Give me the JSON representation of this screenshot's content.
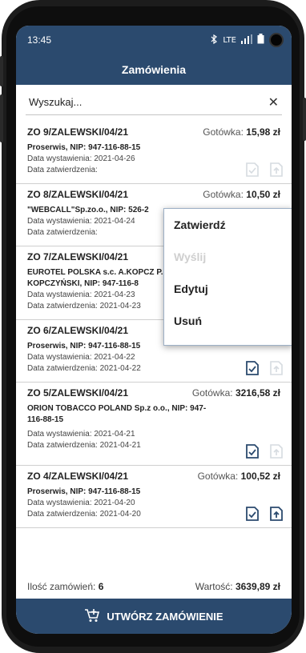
{
  "status_bar": {
    "time": "13:45",
    "network": "LTE"
  },
  "app_bar": {
    "title": "Zamówienia"
  },
  "search": {
    "placeholder": "Wyszukaj...",
    "value": ""
  },
  "orders": [
    {
      "number": "ZO 9/ZALEWSKI/04/21",
      "payment": "Gotówka:",
      "amount": "15,98 zł",
      "client": "Proserwis, NIP: 947-116-88-15",
      "issue_label": "Data wystawienia:",
      "issue_date": "2021-04-26",
      "approve_label": "Data zatwierdzenia:",
      "approve_date": ""
    },
    {
      "number": "ZO 8/ZALEWSKI/04/21",
      "payment": "Gotówka:",
      "amount": "10,50 zł",
      "client": "\"WEBCALL\"Sp.zo.o., NIP: 526-2",
      "issue_label": "Data wystawienia:",
      "issue_date": "2021-04-24",
      "approve_label": "Data zatwierdzenia:",
      "approve_date": ""
    },
    {
      "number": "ZO 7/ZALEWSKI/04/21",
      "payment": "",
      "amount": "",
      "client": "EUROTEL POLSKA s.c. A.KOPCZ P. KOPCZYŃSKI, NIP: 947-116-8",
      "issue_label": "Data wystawienia:",
      "issue_date": "2021-04-23",
      "approve_label": "Data zatwierdzenia:",
      "approve_date": "2021-04-23"
    },
    {
      "number": "ZO 6/ZALEWSKI/04/21",
      "payment": "",
      "amount": "",
      "client": "Proserwis, NIP: 947-116-88-15",
      "issue_label": "Data wystawienia:",
      "issue_date": "2021-04-22",
      "approve_label": "Data zatwierdzenia:",
      "approve_date": "2021-04-22"
    },
    {
      "number": "ZO 5/ZALEWSKI/04/21",
      "payment": "Gotówka:",
      "amount": "3216,58 zł",
      "client": "ORION TOBACCO POLAND Sp.z o.o., NIP: 947-116-88-15",
      "issue_label": "Data wystawienia:",
      "issue_date": "2021-04-21",
      "approve_label": "Data zatwierdzenia:",
      "approve_date": "2021-04-21"
    },
    {
      "number": "ZO 4/ZALEWSKI/04/21",
      "payment": "Gotówka:",
      "amount": "100,52 zł",
      "client": "Proserwis, NIP: 947-116-88-15",
      "issue_label": "Data wystawienia:",
      "issue_date": "2021-04-20",
      "approve_label": "Data zatwierdzenia:",
      "approve_date": "2021-04-20"
    }
  ],
  "summary": {
    "count_label": "Ilość zamówień:",
    "count": "6",
    "value_label": "Wartość:",
    "value": "3639,89 zł"
  },
  "create_button": {
    "label": "UTWÓRZ ZAMÓWIENIE"
  },
  "context_menu": {
    "items": [
      "Zatwierdź",
      "Wyślij",
      "Edytuj",
      "Usuń"
    ]
  },
  "colors": {
    "brand": "#2b4a6e",
    "icon_active": "#2b4a6e",
    "icon_disabled": "#d6dbe0"
  },
  "icons": [
    "battery-icon",
    "signal-icon",
    "bluetooth-icon",
    "close-icon",
    "approve-doc-icon",
    "send-doc-icon",
    "cart-icon"
  ]
}
